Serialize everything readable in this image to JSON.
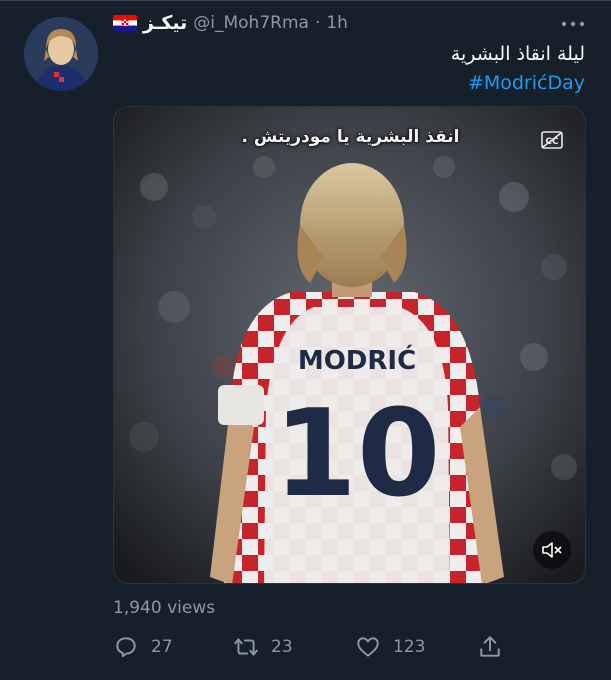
{
  "tweet": {
    "display_name": "تيكـز",
    "handle": "@i_Moh7Rma",
    "separator": "·",
    "time": "1h",
    "text_line": "ليلة انقاذ البشرية",
    "hashtag": "#ModrićDay",
    "media": {
      "caption": "انقذ البشرية يا مودريتش .",
      "jersey_name": "MODRIĆ",
      "jersey_number": "10"
    },
    "views": "1,940 views",
    "actions": {
      "replies": "27",
      "retweets": "23",
      "likes": "123"
    }
  },
  "icons": [
    "more-icon",
    "croatia-flag-icon",
    "captions-icon",
    "mute-icon",
    "reply-icon",
    "retweet-icon",
    "like-icon",
    "share-icon"
  ],
  "colors": {
    "background": "#15202b",
    "text_primary": "#f7f9f9",
    "text_secondary": "#8b98a5",
    "link": "#1d9bf0"
  }
}
